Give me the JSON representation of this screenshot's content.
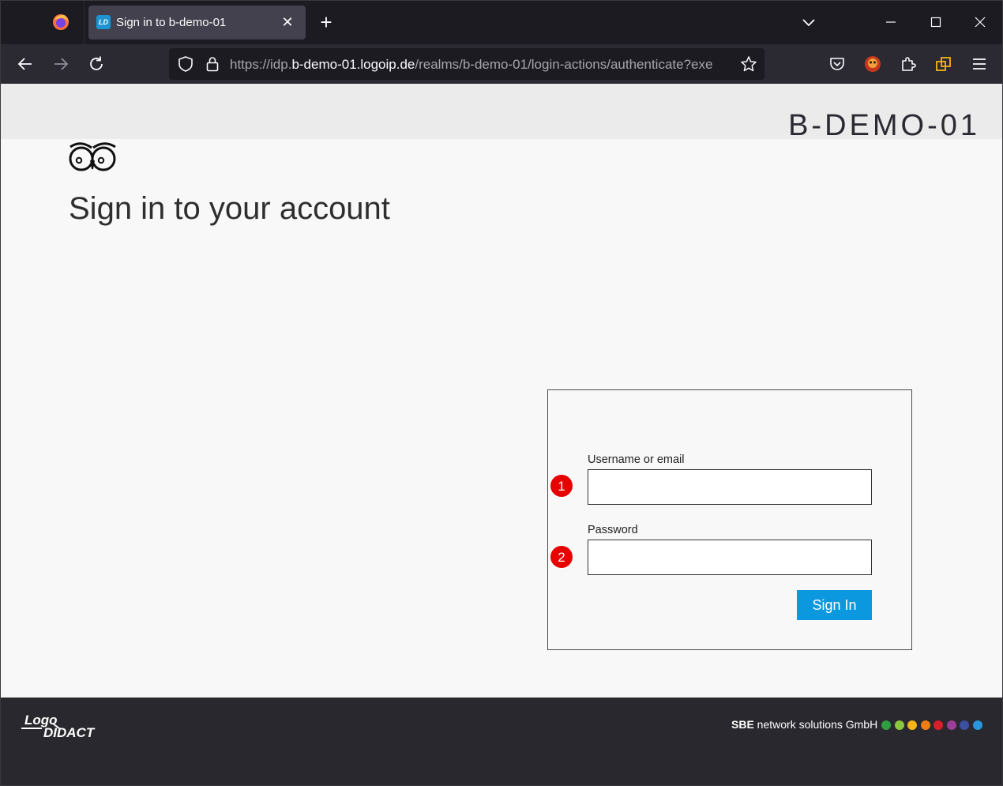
{
  "browser": {
    "tab_title": "Sign in to b-demo-01",
    "tab_favicon_text": "LD",
    "url_prefix": "https://idp.",
    "url_host": "b-demo-01.logoip.de",
    "url_path": "/realms/b-demo-01/login-actions/authenticate?exe"
  },
  "header": {
    "realm_name": "B-DEMO-01"
  },
  "main": {
    "title": "Sign in to your account"
  },
  "login_form": {
    "username_label": "Username or email",
    "username_value": "",
    "password_label": "Password",
    "password_value": "",
    "signin_label": "Sign In",
    "markers": [
      "1",
      "2"
    ]
  },
  "footer": {
    "company_bold": "SBE",
    "company_rest": " network solutions GmbH",
    "dot_colors": [
      "#2e9e3e",
      "#8cc63f",
      "#f5b31a",
      "#f07c14",
      "#d6202a",
      "#9b3f96",
      "#3c4fa0",
      "#2996d9"
    ]
  }
}
